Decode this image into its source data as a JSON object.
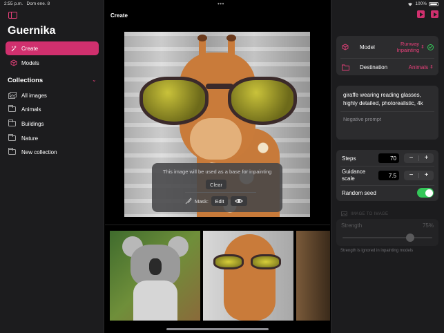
{
  "status_bar": {
    "time": "2:55 p.m.",
    "date": "Dom ene. 8",
    "battery": "100%"
  },
  "sidebar": {
    "app_title": "Guernika",
    "nav": [
      {
        "label": "Create",
        "icon": "sparkles-icon",
        "active": true
      },
      {
        "label": "Models",
        "icon": "cube-icon",
        "active": false
      }
    ],
    "collections_title": "Collections",
    "collections": [
      {
        "label": "All images",
        "icon": "photos-icon"
      },
      {
        "label": "Animals",
        "icon": "folder-icon"
      },
      {
        "label": "Buildings",
        "icon": "folder-icon"
      },
      {
        "label": "Nature",
        "icon": "folder-icon"
      },
      {
        "label": "New collection",
        "icon": "folder-plus-icon"
      }
    ]
  },
  "main": {
    "title": "Create",
    "overlay": {
      "message": "This image will be used as a base for inpainting",
      "clear_label": "Clear",
      "mask_label": "Mask:",
      "edit_label": "Edit"
    }
  },
  "panel": {
    "model_label": "Model",
    "model_value": "Runway Inpainting",
    "destination_label": "Destination",
    "destination_value": "Animals",
    "prompt": "giraffe wearing reading glasses, highly detailed, photorealistic, 4k",
    "negative_placeholder": "Negative prompt",
    "steps_label": "Steps",
    "steps_value": "70",
    "guidance_label": "Guidance scale",
    "guidance_value": "7.5",
    "random_seed_label": "Random seed",
    "random_seed_on": true,
    "image_to_image_label": "IMAGE TO IMAGE",
    "strength_label": "Strength",
    "strength_value": "75%",
    "strength_fraction": 0.75,
    "strength_note": "Strength is ignored in inpainting models"
  },
  "colors": {
    "accent": "#d0306e",
    "toggle_on": "#34c759"
  }
}
